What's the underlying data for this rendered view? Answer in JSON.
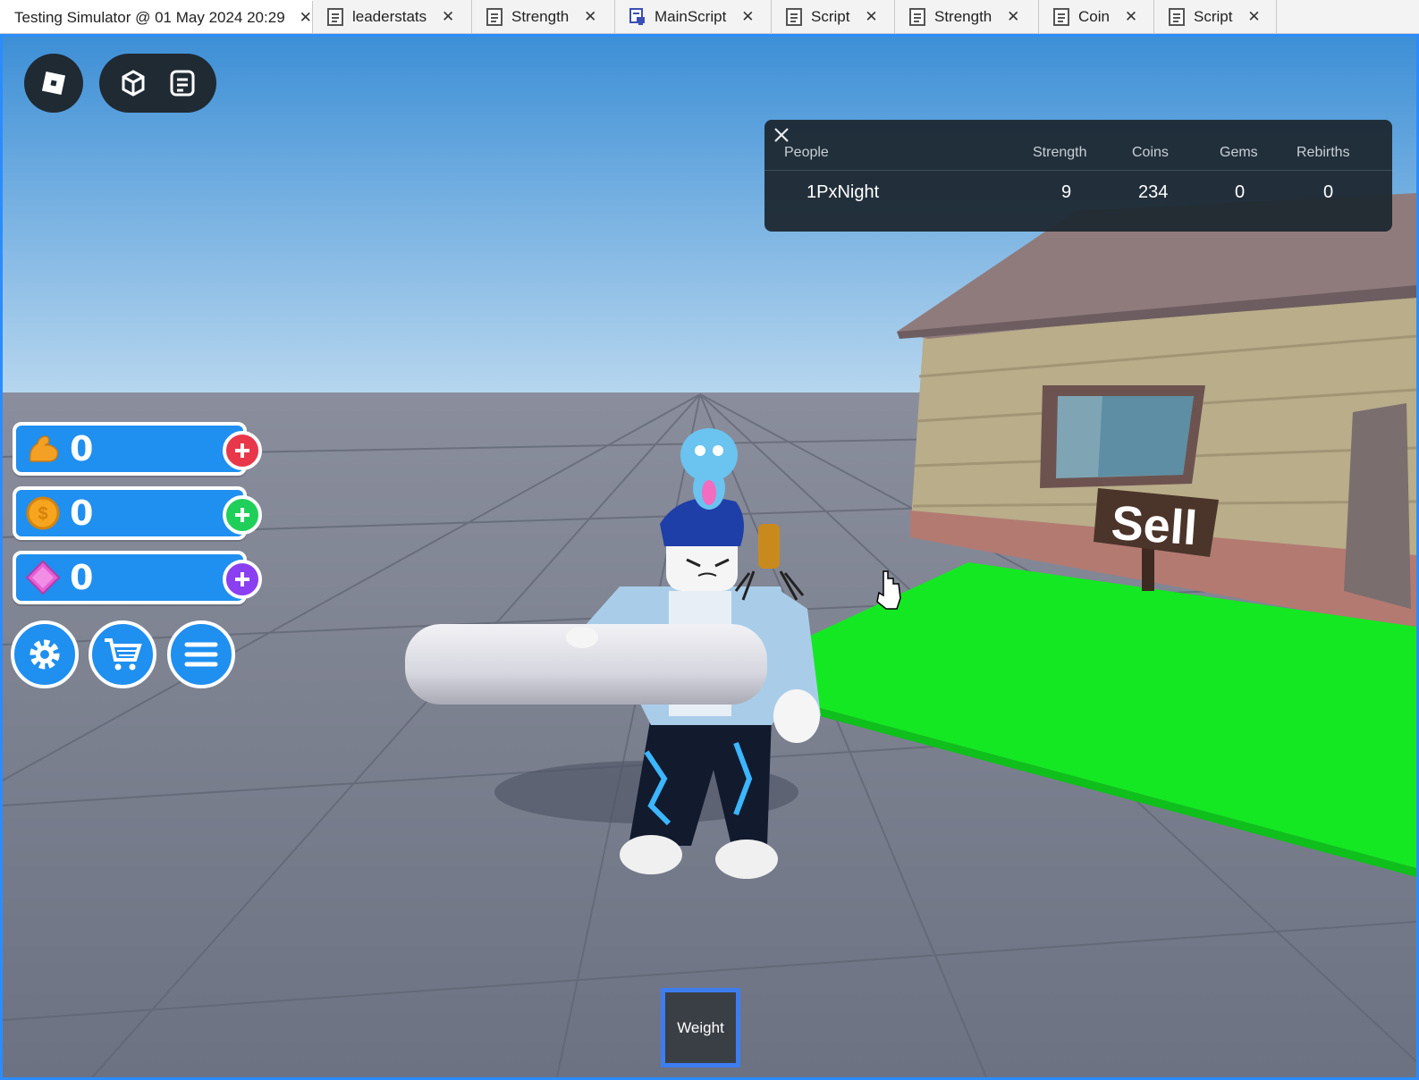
{
  "tabs": [
    {
      "label": "Testing Simulator @ 01 May 2024 20:29",
      "icon": "none",
      "active": true
    },
    {
      "label": "leaderstats",
      "icon": "script-icon"
    },
    {
      "label": "Strength",
      "icon": "script-icon"
    },
    {
      "label": "MainScript",
      "icon": "server-script-icon"
    },
    {
      "label": "Script",
      "icon": "script-icon"
    },
    {
      "label": "Strength",
      "icon": "script-icon"
    },
    {
      "label": "Coin",
      "icon": "script-icon"
    },
    {
      "label": "Script",
      "icon": "script-icon"
    }
  ],
  "leaderboard": {
    "headers": {
      "people": "People",
      "strength": "Strength",
      "coins": "Coins",
      "gems": "Gems",
      "rebirths": "Rebirths"
    },
    "rows": [
      {
        "name": "1PxNight",
        "strength": "9",
        "coins": "234",
        "gems": "0",
        "rebirths": "0"
      }
    ]
  },
  "stats": {
    "strength": {
      "value": "0",
      "icon": "muscle-icon",
      "plus_color": "#e8374a"
    },
    "coins": {
      "value": "0",
      "icon": "coin-icon",
      "plus_color": "#1fcf5a"
    },
    "gems": {
      "value": "0",
      "icon": "gem-icon",
      "plus_color": "#8a3ff0"
    }
  },
  "scene": {
    "sign_text": "Sell",
    "pad_color": "#14e822"
  },
  "hotbar": {
    "slot1_label": "Weight"
  },
  "colors": {
    "accent": "#2b8cff",
    "stat_bar": "#1f8ff0",
    "hud_dark": "#1f2a33"
  }
}
